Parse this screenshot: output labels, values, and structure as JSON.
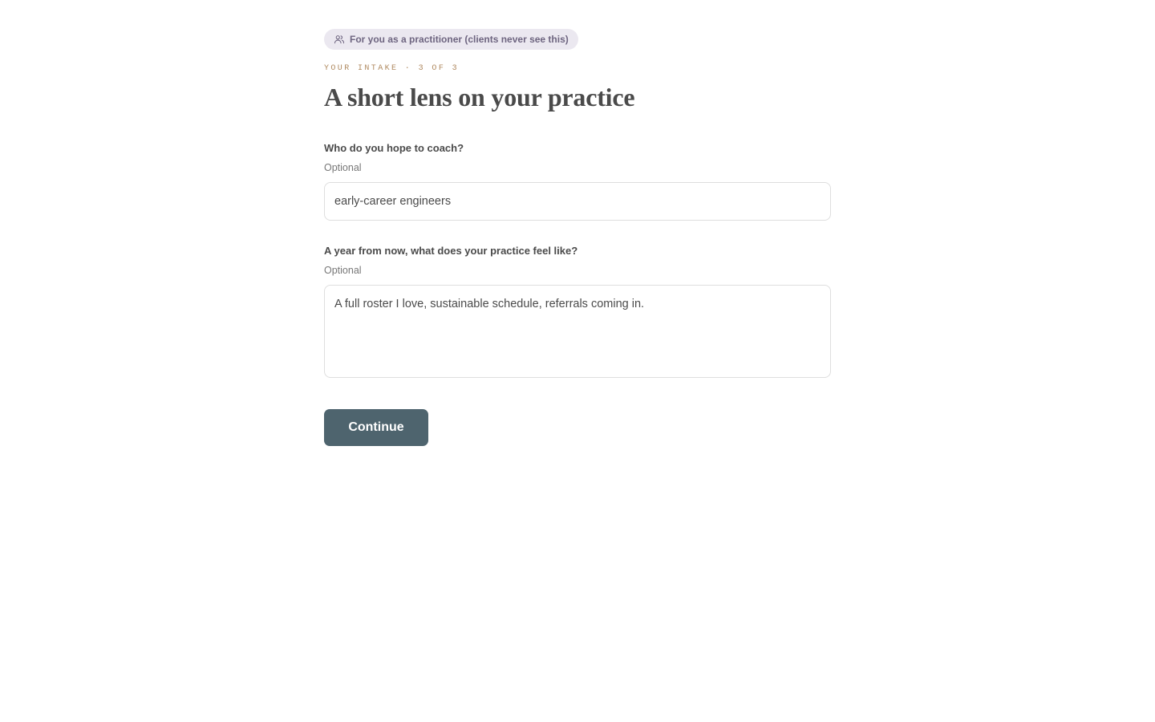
{
  "badge": {
    "icon": "users-icon",
    "text": "For you as a practitioner (clients never see this)",
    "color": "#6e6580",
    "background": "#ebe8f0"
  },
  "header": {
    "eyebrow": "YOUR INTAKE · 3 OF 3",
    "title": "A short lens on your practice"
  },
  "form": {
    "fields": [
      {
        "label": "Who do you hope to coach?",
        "hint": "Optional",
        "value": "early-career engineers"
      },
      {
        "label": "A year from now, what does your practice feel like?",
        "hint": "Optional",
        "value": "A full roster I love, sustainable schedule, referrals coming in."
      }
    ],
    "submit_label": "Continue",
    "submit_color": "#4e646e"
  }
}
